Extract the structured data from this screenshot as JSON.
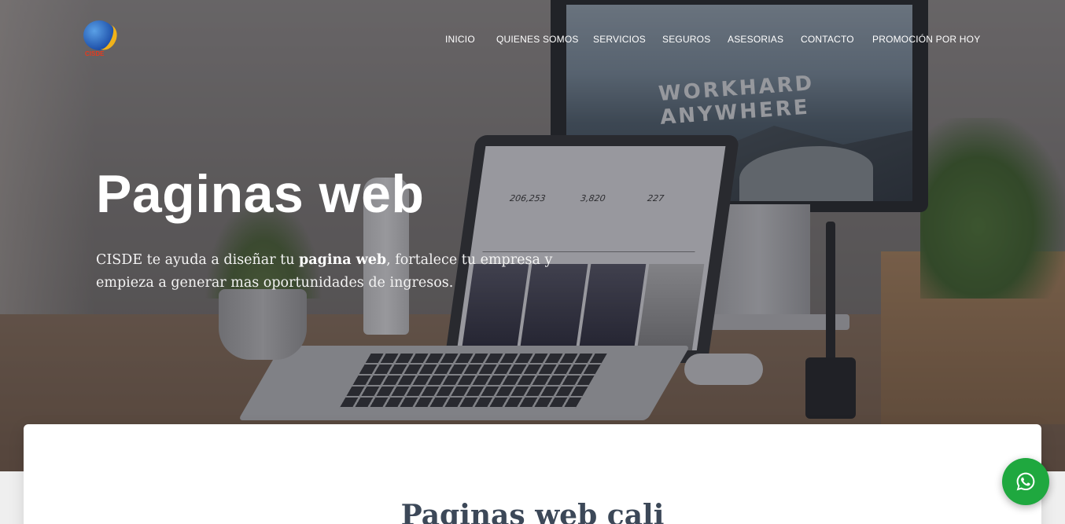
{
  "brand": {
    "logo_text": "CISDE"
  },
  "nav": {
    "items": [
      {
        "label": "INICIO"
      },
      {
        "label": "QUIENES SOMOS"
      },
      {
        "label": "SERVICIOS"
      },
      {
        "label": "SEGUROS"
      },
      {
        "label": "ASESORIAS"
      },
      {
        "label": "CONTACTO"
      },
      {
        "label": "PROMOCIÓN POR HOY"
      }
    ]
  },
  "hero": {
    "title": "Paginas web",
    "desc_before": "CISDE te ayuda a diseñar tu ",
    "desc_bold": "pagina web",
    "desc_after": ", fortalece tu empresa y empieza a generar mas oportunidades de ingresos.",
    "monitor_text_line1": "WORKHARD",
    "monitor_text_line2": "ANYWHERE",
    "laptop_stats": [
      "206,253",
      "3,820",
      "227"
    ]
  },
  "section": {
    "title": "Paginas web cali"
  },
  "colors": {
    "whatsapp": "#1fa83f",
    "title": "#3c4858"
  },
  "icons": {
    "whatsapp": "whatsapp-icon"
  }
}
